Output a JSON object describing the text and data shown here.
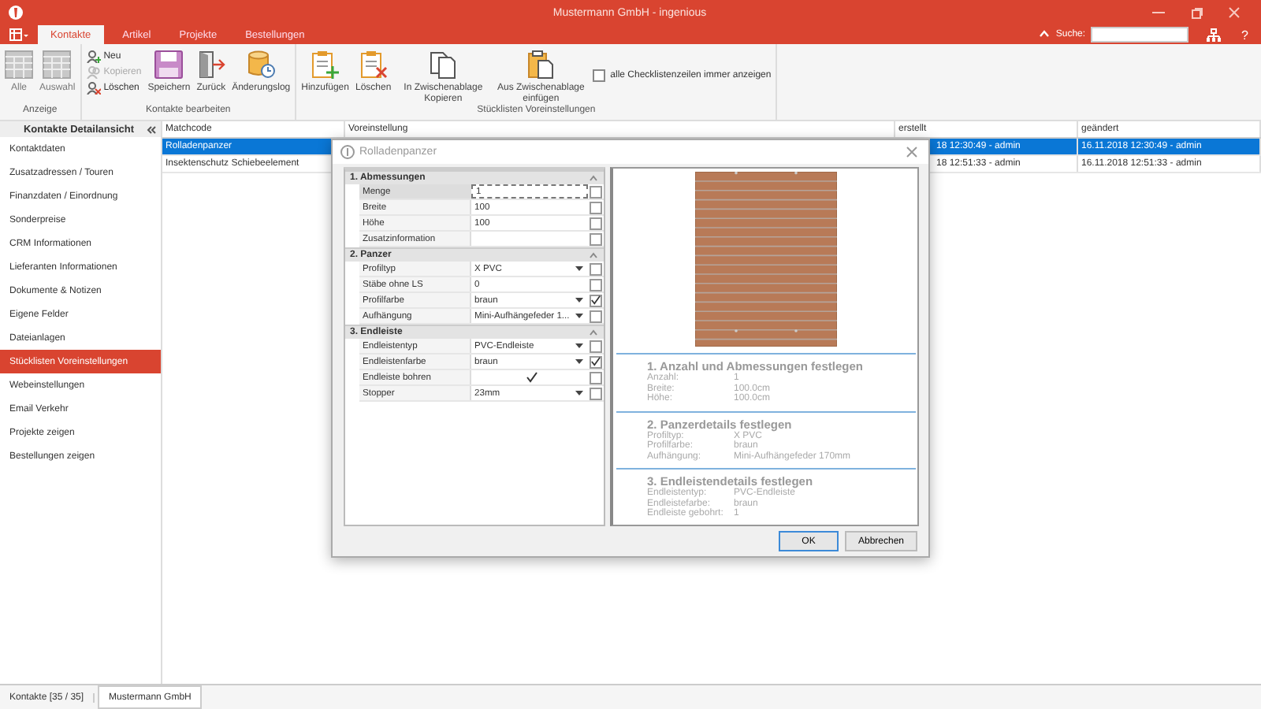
{
  "window": {
    "title": "Mustermann GmbH - ingenious"
  },
  "menu_tabs": [
    {
      "label": "Kontakte",
      "selected": true
    },
    {
      "label": "Artikel",
      "selected": false
    },
    {
      "label": "Projekte",
      "selected": false
    },
    {
      "label": "Bestellungen",
      "selected": false
    }
  ],
  "search": {
    "label": "Suche:"
  },
  "help": "?",
  "ribbon": {
    "groups": [
      {
        "label": "Anzeige",
        "items": [
          {
            "kind": "grid",
            "label": "Alle"
          },
          {
            "kind": "grid",
            "label": "Auswahl"
          }
        ]
      },
      {
        "label": "Kontakte bearbeiten",
        "items": [
          {
            "kind": "stack",
            "buttons": [
              {
                "kind": "person-add",
                "label": "Neu",
                "disabled": false
              },
              {
                "kind": "person-copy",
                "label": "Kopieren",
                "disabled": true
              },
              {
                "kind": "person-delete",
                "label": "Löschen",
                "disabled": false
              }
            ]
          },
          {
            "kind": "save",
            "label": "Speichern"
          },
          {
            "kind": "back",
            "label": "Zurück"
          },
          {
            "kind": "log",
            "label": "Änderungslog"
          }
        ]
      },
      {
        "label": "Stücklisten Voreinstellungen",
        "items": [
          {
            "kind": "add",
            "label": "Hinzufügen"
          },
          {
            "kind": "delete",
            "label": "Löschen"
          },
          {
            "kind": "copy",
            "label": "In Zwischenablage Kopieren"
          },
          {
            "kind": "paste",
            "label": "Aus Zwischenablage einfügen"
          },
          {
            "kind": "checkbox",
            "label": "alle Checklistenzeilen immer anzeigen",
            "checked": false
          }
        ]
      }
    ]
  },
  "sidebar": {
    "title": "Kontakte Detailansicht",
    "items": [
      {
        "label": "Kontaktdaten",
        "selected": false
      },
      {
        "label": "Zusatzadressen / Touren",
        "selected": false
      },
      {
        "label": "Finanzdaten / Einordnung",
        "selected": false
      },
      {
        "label": "Sonderpreise",
        "selected": false
      },
      {
        "label": "CRM Informationen",
        "selected": false
      },
      {
        "label": "Lieferanten Informationen",
        "selected": false
      },
      {
        "label": "Dokumente & Notizen",
        "selected": false
      },
      {
        "label": "Eigene Felder",
        "selected": false
      },
      {
        "label": "Dateianlagen",
        "selected": false
      },
      {
        "label": "Stücklisten Voreinstellungen",
        "selected": true
      },
      {
        "label": "Webeinstellungen",
        "selected": false
      },
      {
        "label": "Email Verkehr",
        "selected": false
      },
      {
        "label": "Projekte zeigen",
        "selected": false
      },
      {
        "label": "Bestellungen zeigen",
        "selected": false
      }
    ]
  },
  "grid": {
    "columns": [
      "Matchcode",
      "Voreinstellung",
      "erstellt",
      "geändert"
    ],
    "rows": [
      {
        "selected": true,
        "matchcode": "Rolladenpanzer",
        "erstellt": "18 12:30:49 - admin",
        "geaendert": "16.11.2018 12:30:49 - admin"
      },
      {
        "selected": false,
        "matchcode": "Insektenschutz Schiebeelement",
        "erstellt": "18 12:51:33 - admin",
        "geaendert": "16.11.2018 12:51:33 - admin"
      }
    ]
  },
  "dialog": {
    "title": "Rolladenpanzer",
    "sections": [
      {
        "title": "1. Abmessungen",
        "expanded": true,
        "rows": [
          {
            "label": "Menge",
            "kind": "text",
            "value": "1",
            "selected": true,
            "checked": false
          },
          {
            "label": "Breite",
            "kind": "text",
            "value": "100",
            "selected": false,
            "checked": false
          },
          {
            "label": "Höhe",
            "kind": "text",
            "value": "100",
            "selected": false,
            "checked": false
          },
          {
            "label": "Zusatzinformation",
            "kind": "text",
            "selected": false,
            "checked": false
          }
        ]
      },
      {
        "title": "2. Panzer",
        "expanded": true,
        "rows": [
          {
            "label": "Profiltyp",
            "kind": "dropdown",
            "value": "X PVC",
            "selected": false,
            "checked": false
          },
          {
            "label": "Stäbe ohne LS",
            "kind": "text",
            "value": "0",
            "selected": false,
            "checked": false
          },
          {
            "label": "Profilfarbe",
            "kind": "dropdown",
            "value": "braun",
            "selected": false,
            "checked": true
          },
          {
            "label": "Aufhängung",
            "kind": "dropdown",
            "value": "Mini-Aufhängefeder 1...",
            "selected": false,
            "checked": false
          }
        ]
      },
      {
        "title": "3. Endleiste",
        "expanded": true,
        "rows": [
          {
            "label": "Endleistentyp",
            "kind": "dropdown",
            "value": "PVC-Endleiste",
            "selected": false,
            "checked": false
          },
          {
            "label": "Endleistenfarbe",
            "kind": "dropdown",
            "value": "braun",
            "selected": false,
            "checked": true
          },
          {
            "label": "Endleiste bohren",
            "kind": "checkbox",
            "value_checked": true,
            "selected": false,
            "checked": false
          },
          {
            "label": "Stopper",
            "kind": "dropdown",
            "value": "23mm",
            "selected": false,
            "checked": false
          }
        ]
      }
    ],
    "summary": [
      {
        "title": "1. Anzahl und Abmessungen festlegen",
        "rows": [
          {
            "label": "Anzahl:",
            "value": "1"
          },
          {
            "label": "Breite:",
            "value": "100.0cm"
          },
          {
            "label": "Höhe:",
            "value": "100.0cm"
          }
        ]
      },
      {
        "title": "2. Panzerdetails festlegen",
        "rows": [
          {
            "label": "Profiltyp:",
            "value": "X PVC"
          },
          {
            "label": "Profilfarbe:",
            "value": "braun"
          },
          {
            "label": "Aufhängung:",
            "value": "Mini-Aufhängefeder 170mm"
          }
        ]
      },
      {
        "title": "3. Endleistendetails festlegen",
        "rows": [
          {
            "label": "Endleistentyp:",
            "value": "PVC-Endleiste"
          },
          {
            "label": "Endleistefarbe:",
            "value": "braun"
          },
          {
            "label": "Endleiste gebohrt:",
            "value": "1"
          }
        ]
      }
    ],
    "buttons": [
      {
        "label": "OK",
        "default": true
      },
      {
        "label": "Abbrechen",
        "default": false
      }
    ]
  },
  "status_bar": {
    "count": "Kontakte [35 / 35]",
    "tabs": [
      {
        "label": "Mustermann GmbH",
        "selected": true
      }
    ]
  }
}
